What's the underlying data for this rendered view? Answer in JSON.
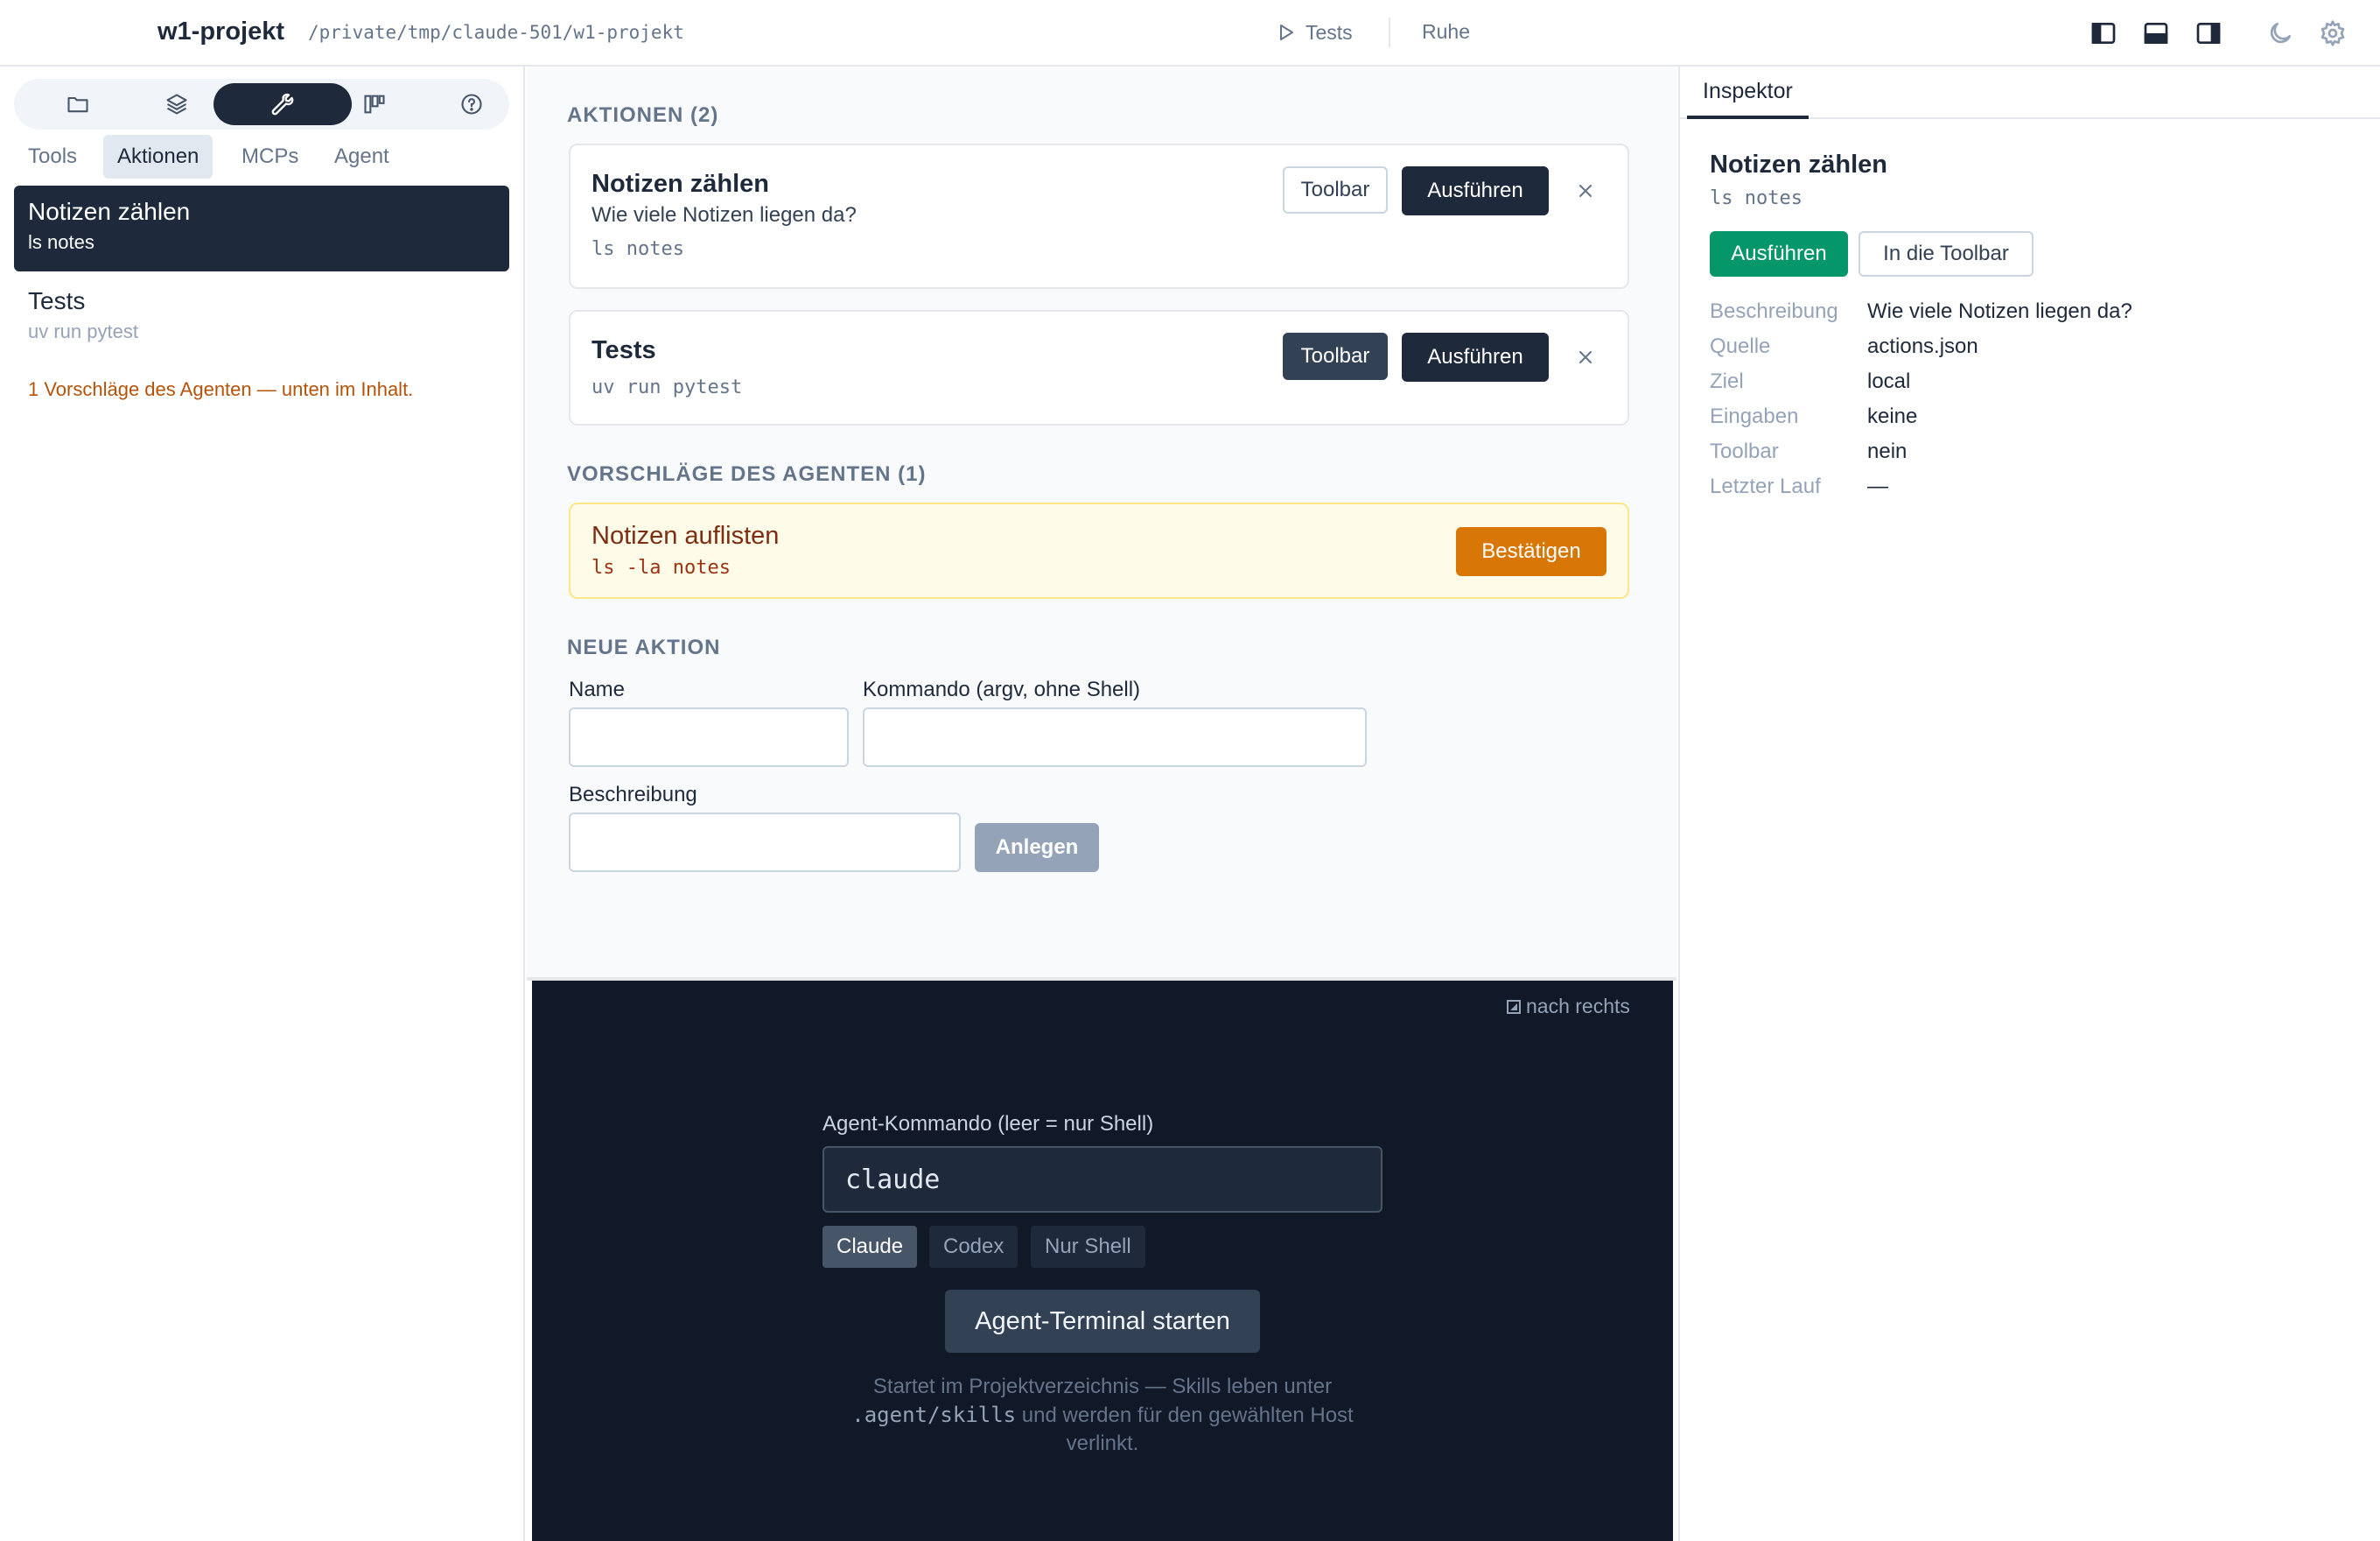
{
  "header": {
    "title": "w1-projekt",
    "path": "/private/tmp/claude-501/w1-projekt",
    "run_label": "Tests",
    "status": "Ruhe",
    "icons": [
      "layout-left-icon",
      "layout-bottom-icon",
      "layout-right-icon",
      "moon-icon",
      "gear-icon"
    ]
  },
  "sidebar": {
    "mode_icons": [
      "folder-icon",
      "layers-icon",
      "wrench-icon",
      "kanban-icon",
      "help-icon"
    ],
    "active_mode": "wrench-icon",
    "tabs": [
      "Tools",
      "Aktionen",
      "MCPs",
      "Agent"
    ],
    "active_tab": "Aktionen",
    "items": [
      {
        "title": "Notizen zählen",
        "cmd": "ls notes"
      },
      {
        "title": "Tests",
        "cmd": "uv run pytest"
      }
    ],
    "agent_note": "1 Vorschläge des Agenten — unten im Inhalt."
  },
  "main": {
    "actions_heading": "AKTIONEN (2)",
    "actions": [
      {
        "title": "Notizen zählen",
        "description": "Wie viele Notizen liegen da?",
        "cmd": "ls notes",
        "toolbar_label": "Toolbar",
        "toolbar_active": false,
        "run_label": "Ausführen"
      },
      {
        "title": "Tests",
        "description": "",
        "cmd": "uv run pytest",
        "toolbar_label": "Toolbar",
        "toolbar_active": true,
        "run_label": "Ausführen"
      }
    ],
    "suggestions_heading": "VORSCHLÄGE DES AGENTEN (1)",
    "suggestion": {
      "title": "Notizen auflisten",
      "cmd": "ls -la notes",
      "confirm_label": "Bestätigen"
    },
    "new_action": {
      "heading": "NEUE AKTION",
      "name_label": "Name",
      "name_value": "",
      "cmd_label": "Kommando (argv, ohne Shell)",
      "cmd_value": "",
      "desc_label": "Beschreibung",
      "desc_value": "",
      "create_label": "Anlegen"
    }
  },
  "terminal": {
    "dock_label": "nach rechts",
    "cmd_label": "Agent-Kommando (leer = nur Shell)",
    "cmd_value": "claude",
    "presets": [
      "Claude",
      "Codex",
      "Nur Shell"
    ],
    "active_preset": "Claude",
    "start_label": "Agent-Terminal starten",
    "hint_before": "Startet im Projektverzeichnis — Skills leben unter",
    "hint_code": ".agent/skills",
    "hint_after": "und werden für den gewählten Host verlinkt."
  },
  "inspector": {
    "tab": "Inspektor",
    "title": "Notizen zählen",
    "cmd": "ls notes",
    "run_label": "Ausführen",
    "toolbar_label": "In die Toolbar",
    "fields": [
      {
        "key": "Beschreibung",
        "value": "Wie viele Notizen liegen da?"
      },
      {
        "key": "Quelle",
        "value": "actions.json"
      },
      {
        "key": "Ziel",
        "value": "local"
      },
      {
        "key": "Eingaben",
        "value": "keine"
      },
      {
        "key": "Toolbar",
        "value": "nein"
      },
      {
        "key": "Letzter Lauf",
        "value": "—"
      }
    ]
  }
}
